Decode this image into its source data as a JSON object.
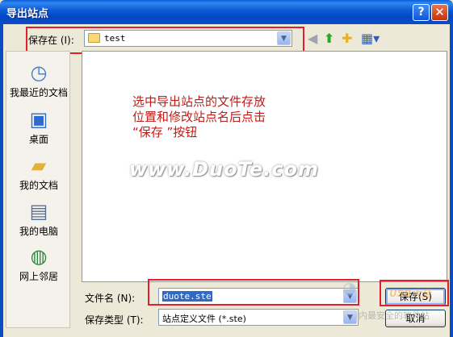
{
  "window": {
    "title": "导出站点",
    "help_glyph": "?",
    "close_glyph": "✕"
  },
  "save_in": {
    "label": "保存在 (I):",
    "value": "test"
  },
  "places": [
    {
      "label": "我最近的文档",
      "icon": "recent-documents-icon"
    },
    {
      "label": "桌面",
      "icon": "desktop-icon"
    },
    {
      "label": "我的文档",
      "icon": "my-documents-icon"
    },
    {
      "label": "我的电脑",
      "icon": "my-computer-icon"
    },
    {
      "label": "网上邻居",
      "icon": "network-places-icon"
    }
  ],
  "annotation": {
    "line1": "选中导出站点的文件存放",
    "line2": "位置和修改站点名后点击",
    "line3": "“保存 ”按钮"
  },
  "watermark": "www.DuoTe.com",
  "file_name": {
    "label": "文件名 (N):",
    "value": "duote.ste"
  },
  "file_type": {
    "label": "保存类型 (T):",
    "value": "站点定义文件 (*.ste)"
  },
  "buttons": {
    "save": "保存(S)",
    "cancel": "取消"
  },
  "corner_logo": {
    "text1": "USB大全",
    "text2": "内最安全的软件站"
  },
  "colors": {
    "title_bar": "#0A58D0",
    "highlight_box": "#E0202A",
    "annotation": "#C11B17"
  }
}
